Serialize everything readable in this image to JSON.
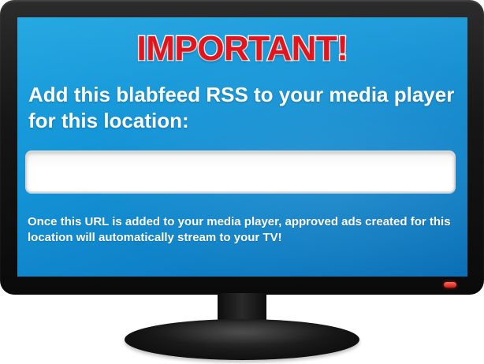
{
  "screen": {
    "headline": "IMPORTANT!",
    "instruction": "Add this blabfeed RSS to your media player for this location:",
    "url_field": {
      "value": "",
      "placeholder": ""
    },
    "note": "Once this URL is added to your media player, approved ads created for this location will automatically stream to your TV!"
  },
  "colors": {
    "screen_blue": "#1596d8",
    "headline_red": "#e3141b",
    "bezel": "#161616",
    "power_led": "#d11a10"
  }
}
